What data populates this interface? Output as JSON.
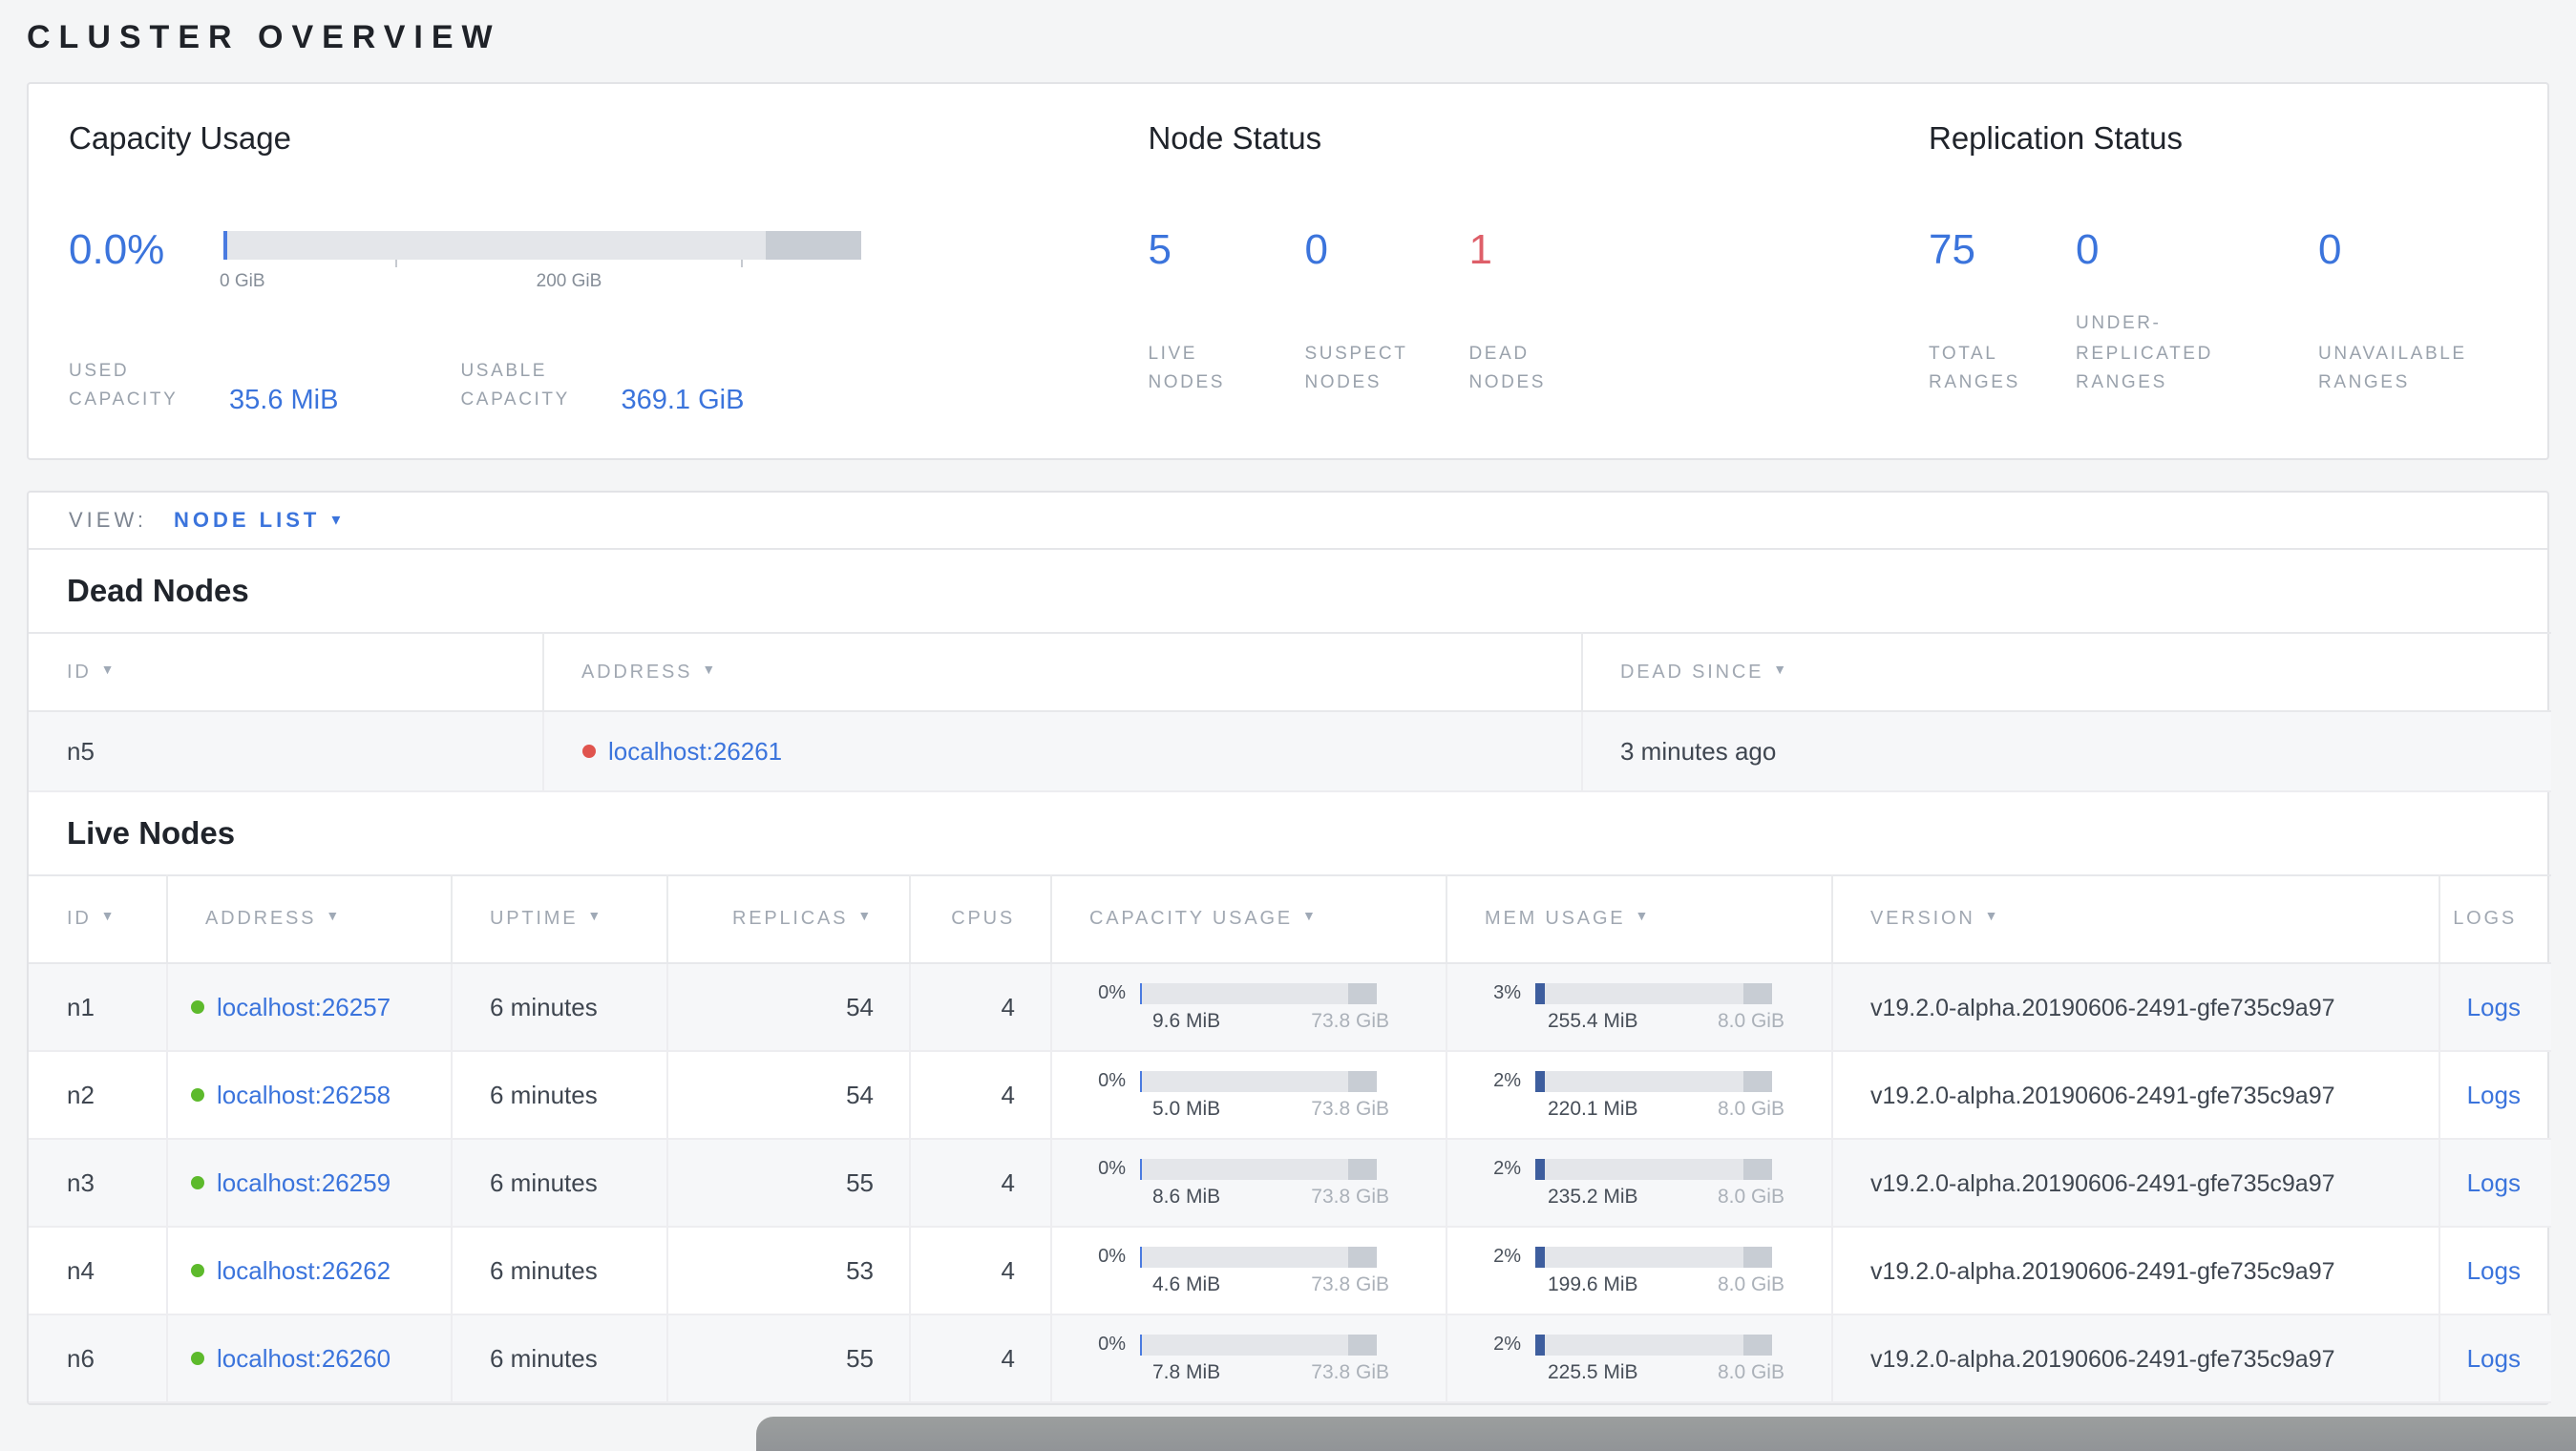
{
  "page": {
    "title": "CLUSTER OVERVIEW"
  },
  "colors": {
    "blue": "#3b74dc",
    "red": "#de5f69",
    "green_dot": "#5dba2c",
    "red_dot": "#e0544e",
    "label_gray": "#9aa2ac",
    "text_dark": "#3f4650",
    "bar_track": "#e4e6ea",
    "bar_segment": "#c8cdd4",
    "bar_capacity_fill": "#4a7be0",
    "bar_mem_fill": "#3e5e9e",
    "bottom_bar": "#97999c"
  },
  "summary": {
    "capacity": {
      "heading": "Capacity Usage",
      "percent": "0.0%",
      "axis_labels": [
        "0 GiB",
        "200 GiB"
      ],
      "used": {
        "label": "USED CAPACITY",
        "value": "35.6 MiB"
      },
      "usable": {
        "label": "USABLE CAPACITY",
        "value": "369.1 GiB"
      }
    },
    "node_status": {
      "heading": "Node Status",
      "stats": [
        {
          "value": "5",
          "label": "LIVE NODES",
          "color": "#3b74dc"
        },
        {
          "value": "0",
          "label": "SUSPECT NODES",
          "color": "#3b74dc"
        },
        {
          "value": "1",
          "label": "DEAD NODES",
          "color": "#de5f69"
        }
      ]
    },
    "replication": {
      "heading": "Replication Status",
      "stats": [
        {
          "value": "75",
          "label": "TOTAL RANGES",
          "color": "#3b74dc"
        },
        {
          "value": "0",
          "label": "UNDER-REPLICATED RANGES",
          "color": "#3b74dc"
        },
        {
          "value": "0",
          "label": "UNAVAILABLE RANGES",
          "color": "#3b74dc"
        }
      ]
    }
  },
  "view_bar": {
    "label": "VIEW:",
    "selected": "NODE LIST",
    "caret": "▾"
  },
  "dead_nodes": {
    "heading": "Dead Nodes",
    "columns": [
      {
        "label": "ID",
        "sortable": true
      },
      {
        "label": "ADDRESS",
        "sortable": true
      },
      {
        "label": "DEAD SINCE",
        "sortable": true
      }
    ],
    "rows": [
      {
        "id": "n5",
        "address": "localhost:26261",
        "dead_since": "3 minutes ago"
      }
    ]
  },
  "live_nodes": {
    "heading": "Live Nodes",
    "columns": [
      {
        "label": "ID",
        "sortable": true
      },
      {
        "label": "ADDRESS",
        "sortable": true
      },
      {
        "label": "UPTIME",
        "sortable": true
      },
      {
        "label": "REPLICAS",
        "sortable": true,
        "align": "right"
      },
      {
        "label": "CPUS",
        "sortable": false,
        "align": "right"
      },
      {
        "label": "CAPACITY USAGE",
        "sortable": true
      },
      {
        "label": "MEM USAGE",
        "sortable": true
      },
      {
        "label": "VERSION",
        "sortable": true
      },
      {
        "label": "LOGS",
        "sortable": false,
        "align": "right"
      }
    ],
    "rows": [
      {
        "id": "n1",
        "address": "localhost:26257",
        "uptime": "6 minutes",
        "replicas": "54",
        "cpus": "4",
        "capacity": {
          "percent": "0%",
          "used": "9.6 MiB",
          "total": "73.8 GiB"
        },
        "mem": {
          "percent": "3%",
          "used": "255.4 MiB",
          "total": "8.0 GiB"
        },
        "version": "v19.2.0-alpha.20190606-2491-gfe735c9a97",
        "logs_label": "Logs"
      },
      {
        "id": "n2",
        "address": "localhost:26258",
        "uptime": "6 minutes",
        "replicas": "54",
        "cpus": "4",
        "capacity": {
          "percent": "0%",
          "used": "5.0 MiB",
          "total": "73.8 GiB"
        },
        "mem": {
          "percent": "2%",
          "used": "220.1 MiB",
          "total": "8.0 GiB"
        },
        "version": "v19.2.0-alpha.20190606-2491-gfe735c9a97",
        "logs_label": "Logs"
      },
      {
        "id": "n3",
        "address": "localhost:26259",
        "uptime": "6 minutes",
        "replicas": "55",
        "cpus": "4",
        "capacity": {
          "percent": "0%",
          "used": "8.6 MiB",
          "total": "73.8 GiB"
        },
        "mem": {
          "percent": "2%",
          "used": "235.2 MiB",
          "total": "8.0 GiB"
        },
        "version": "v19.2.0-alpha.20190606-2491-gfe735c9a97",
        "logs_label": "Logs"
      },
      {
        "id": "n4",
        "address": "localhost:26262",
        "uptime": "6 minutes",
        "replicas": "53",
        "cpus": "4",
        "capacity": {
          "percent": "0%",
          "used": "4.6 MiB",
          "total": "73.8 GiB"
        },
        "mem": {
          "percent": "2%",
          "used": "199.6 MiB",
          "total": "8.0 GiB"
        },
        "version": "v19.2.0-alpha.20190606-2491-gfe735c9a97",
        "logs_label": "Logs"
      },
      {
        "id": "n6",
        "address": "localhost:26260",
        "uptime": "6 minutes",
        "replicas": "55",
        "cpus": "4",
        "capacity": {
          "percent": "0%",
          "used": "7.8 MiB",
          "total": "73.8 GiB"
        },
        "mem": {
          "percent": "2%",
          "used": "225.5 MiB",
          "total": "8.0 GiB"
        },
        "version": "v19.2.0-alpha.20190606-2491-gfe735c9a97",
        "logs_label": "Logs"
      }
    ]
  }
}
